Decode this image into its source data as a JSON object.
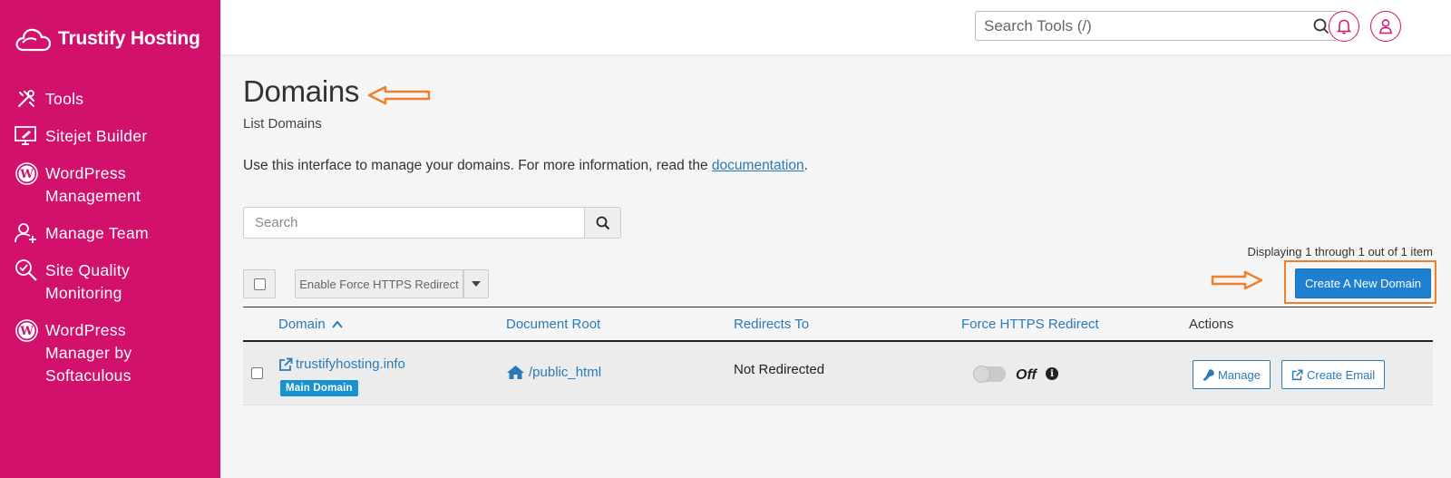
{
  "brand": {
    "name": "Trustify Hosting",
    "logo_icon": "cloud-icon",
    "color": "#d2116d"
  },
  "sidebar": {
    "items": [
      {
        "label": "Tools",
        "icon": "tools-icon"
      },
      {
        "label": "Sitejet Builder",
        "icon": "monitor-pen-icon"
      },
      {
        "label": "WordPress\nManagement",
        "icon": "wordpress-icon"
      },
      {
        "label": "Manage Team",
        "icon": "user-add-icon"
      },
      {
        "label": "Site Quality\nMonitoring",
        "icon": "magnify-check-icon"
      },
      {
        "label": "WordPress\nManager by\nSoftaculous",
        "icon": "wordpress-icon"
      }
    ]
  },
  "header": {
    "search_placeholder": "Search Tools (/)",
    "notifications_icon": "bell-icon",
    "user_icon": "user-icon"
  },
  "page": {
    "title": "Domains",
    "subtitle": "List Domains",
    "intro_text": "Use this interface to manage your domains. For more information, read the ",
    "intro_link": "documentation",
    "intro_end": "."
  },
  "search": {
    "placeholder": "Search",
    "button_icon": "search-icon"
  },
  "pagination": {
    "text": "Displaying 1 through 1 out of 1 item"
  },
  "toolbar": {
    "bulk_action": "Enable Force HTTPS Redirect",
    "create_button": "Create A New Domain"
  },
  "table": {
    "columns": [
      "Domain",
      "Document Root",
      "Redirects To",
      "Force HTTPS Redirect",
      "Actions"
    ],
    "sort_column": "Domain",
    "rows": [
      {
        "domain": "trustifyhosting.info",
        "badge": "Main Domain",
        "document_root": "/public_html",
        "redirects_to": "Not Redirected",
        "force_https": "Off",
        "actions": [
          "Manage",
          "Create Email"
        ]
      }
    ]
  },
  "accent_colors": {
    "link": "#2a7ab8",
    "primary_button": "#1f7fd1",
    "annotation": "#f07f2e",
    "badge": "#1992cf"
  }
}
